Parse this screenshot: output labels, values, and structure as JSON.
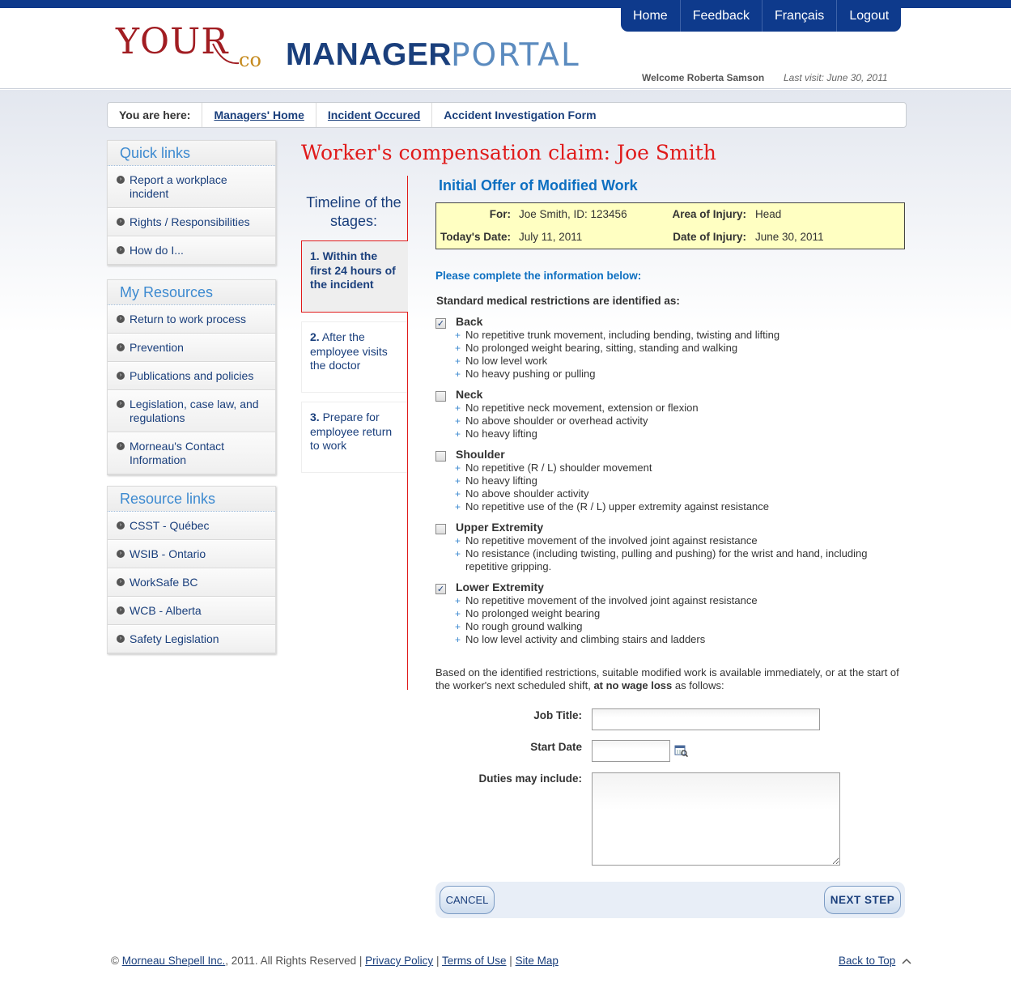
{
  "header": {
    "logo_your": "YOUR",
    "logo_co": "co",
    "logo_manager": "MANAGER",
    "logo_portal": "PORTAL",
    "nav": [
      "Home",
      "Feedback",
      "Français",
      "Logout"
    ],
    "welcome": "Welcome Roberta Samson",
    "last_visit": "Last visit: June 30, 2011"
  },
  "breadcrumb": {
    "label": "You are here:",
    "items": [
      "Managers' Home",
      "Incident Occured",
      "Accident Investigation Form"
    ]
  },
  "sidebar": {
    "quick_links": {
      "title": "Quick links",
      "items": [
        "Report a workplace incident",
        "Rights / Responsibilities",
        "How do I..."
      ]
    },
    "my_resources": {
      "title": "My Resources",
      "items": [
        "Return to work process",
        "Prevention",
        "Publications and policies",
        "Legislation, case law, and regulations",
        "Morneau's Contact Information"
      ]
    },
    "resource_links": {
      "title": "Resource links",
      "items": [
        "CSST - Québec",
        "WSIB - Ontario",
        "WorkSafe BC",
        "WCB - Alberta",
        "Safety Legislation"
      ]
    }
  },
  "page_title": "Worker's compensation claim: Joe Smith",
  "timeline": {
    "heading": "Timeline of the stages:",
    "steps": [
      {
        "num": "1.",
        "text": "Within the first 24 hours of the incident"
      },
      {
        "num": "2.",
        "text": "After the employee visits the doctor"
      },
      {
        "num": "3.",
        "text": "Prepare for employee return to work"
      }
    ]
  },
  "form": {
    "section_title": "Initial Offer of Modified Work",
    "info": {
      "for_label": "For:",
      "for_value": "Joe Smith, ID: 123456",
      "area_label": "Area of Injury:",
      "area_value": "Head",
      "today_label": "Today's Date:",
      "today_value": "July 11, 2011",
      "date_label": "Date of Injury:",
      "date_value": "June 30, 2011"
    },
    "please": "Please complete the information below:",
    "standard": "Standard medical restrictions are identified as:",
    "groups": [
      {
        "title": "Back",
        "checked": true,
        "items": [
          "No repetitive trunk movement, including bending, twisting and lifting",
          "No prolonged weight bearing, sitting, standing and walking",
          "No low level work",
          "No heavy pushing or pulling"
        ]
      },
      {
        "title": "Neck",
        "checked": false,
        "items": [
          "No repetitive neck movement, extension or flexion",
          "No above shoulder or overhead activity",
          "No heavy lifting"
        ]
      },
      {
        "title": "Shoulder",
        "checked": false,
        "items": [
          "No repetitive (R / L) shoulder movement",
          "No heavy lifting",
          "No above shoulder activity",
          "No repetitive use of the (R / L) upper extremity against resistance"
        ]
      },
      {
        "title": "Upper Extremity",
        "checked": false,
        "items": [
          "No repetitive movement of the involved joint against resistance",
          "No resistance (including twisting, pulling and pushing) for the wrist and hand, including repetitive gripping."
        ]
      },
      {
        "title": "Lower Extremity",
        "checked": true,
        "items": [
          "No repetitive movement of the involved joint against resistance",
          "No prolonged weight bearing",
          "No rough ground walking",
          "No low level activity and climbing stairs and ladders"
        ]
      }
    ],
    "based_text": "Based on the identified restrictions, suitable modified work is available immediately, or at the start of the worker's next scheduled shift,",
    "based_bold": "at no wage loss",
    "based_end": "as follows:",
    "job_title_label": "Job Title:",
    "job_title_value": "",
    "start_date_label": "Start Date",
    "start_date_value": "",
    "duties_label": "Duties may include:",
    "duties_value": "",
    "cancel": "CANCEL",
    "next": "NEXT STEP"
  },
  "footer": {
    "copyright": "©",
    "company": "Morneau Shepell Inc.",
    "rights": ", 2011. All Rights Reserved |",
    "privacy": "Privacy Policy",
    "sep1": "|",
    "terms": "Terms of Use",
    "sep2": "|",
    "sitemap": "Site Map",
    "back_to_top": "Back to Top"
  },
  "colors": {
    "brand_blue": "#0e3a8c",
    "accent_red": "#e01b1b",
    "link_blue": "#1a3f7c",
    "section_blue": "#0d6fc1",
    "info_yellow": "#ffffc2"
  }
}
